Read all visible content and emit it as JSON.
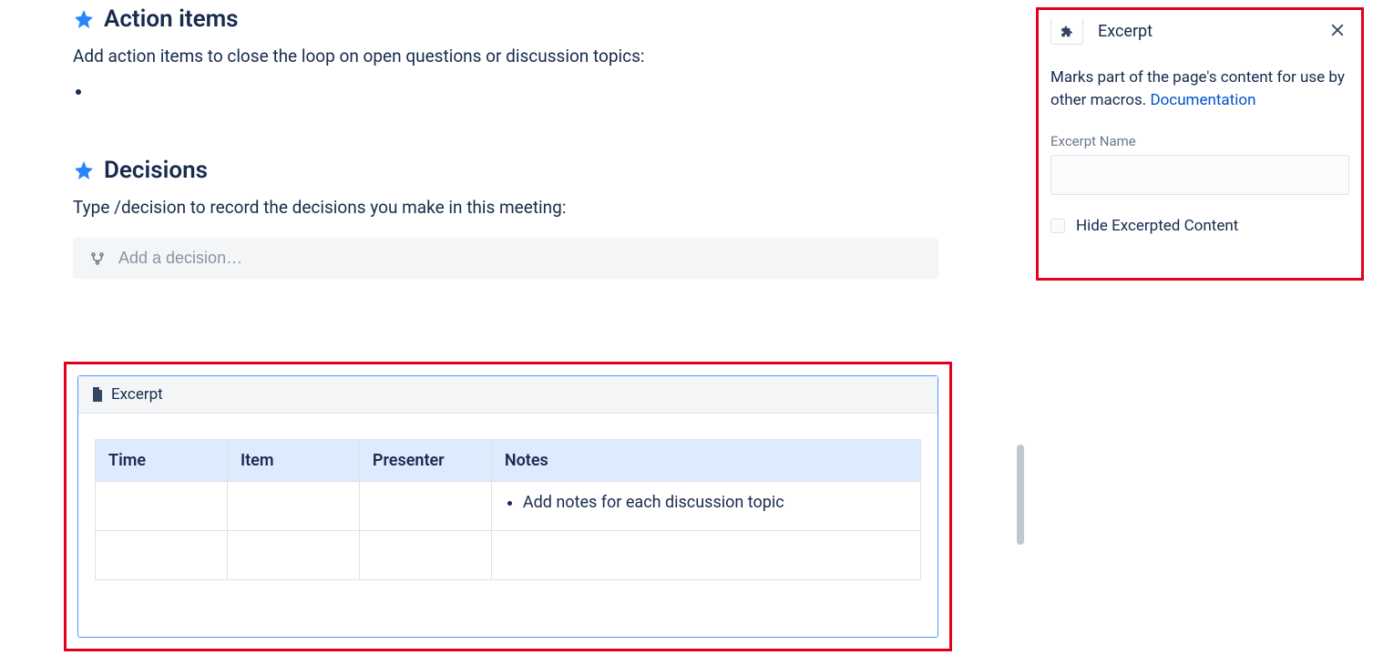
{
  "main": {
    "action_items": {
      "title": "Action items",
      "description": "Add action items to close the loop on open questions or discussion topics:"
    },
    "decisions": {
      "title": "Decisions",
      "description": "Type /decision to record the decisions you make in this meeting:",
      "placeholder": "Add a decision…"
    },
    "excerpt": {
      "label": "Excerpt",
      "table": {
        "headers": [
          "Time",
          "Item",
          "Presenter",
          "Notes"
        ],
        "note_text": "Add notes for each discussion topic"
      }
    }
  },
  "side_panel": {
    "title": "Excerpt",
    "description": "Marks part of the page's content for use by other macros. ",
    "doc_link_text": "Documentation",
    "name_label": "Excerpt Name",
    "name_value": "",
    "hide_label": "Hide Excerpted Content"
  }
}
